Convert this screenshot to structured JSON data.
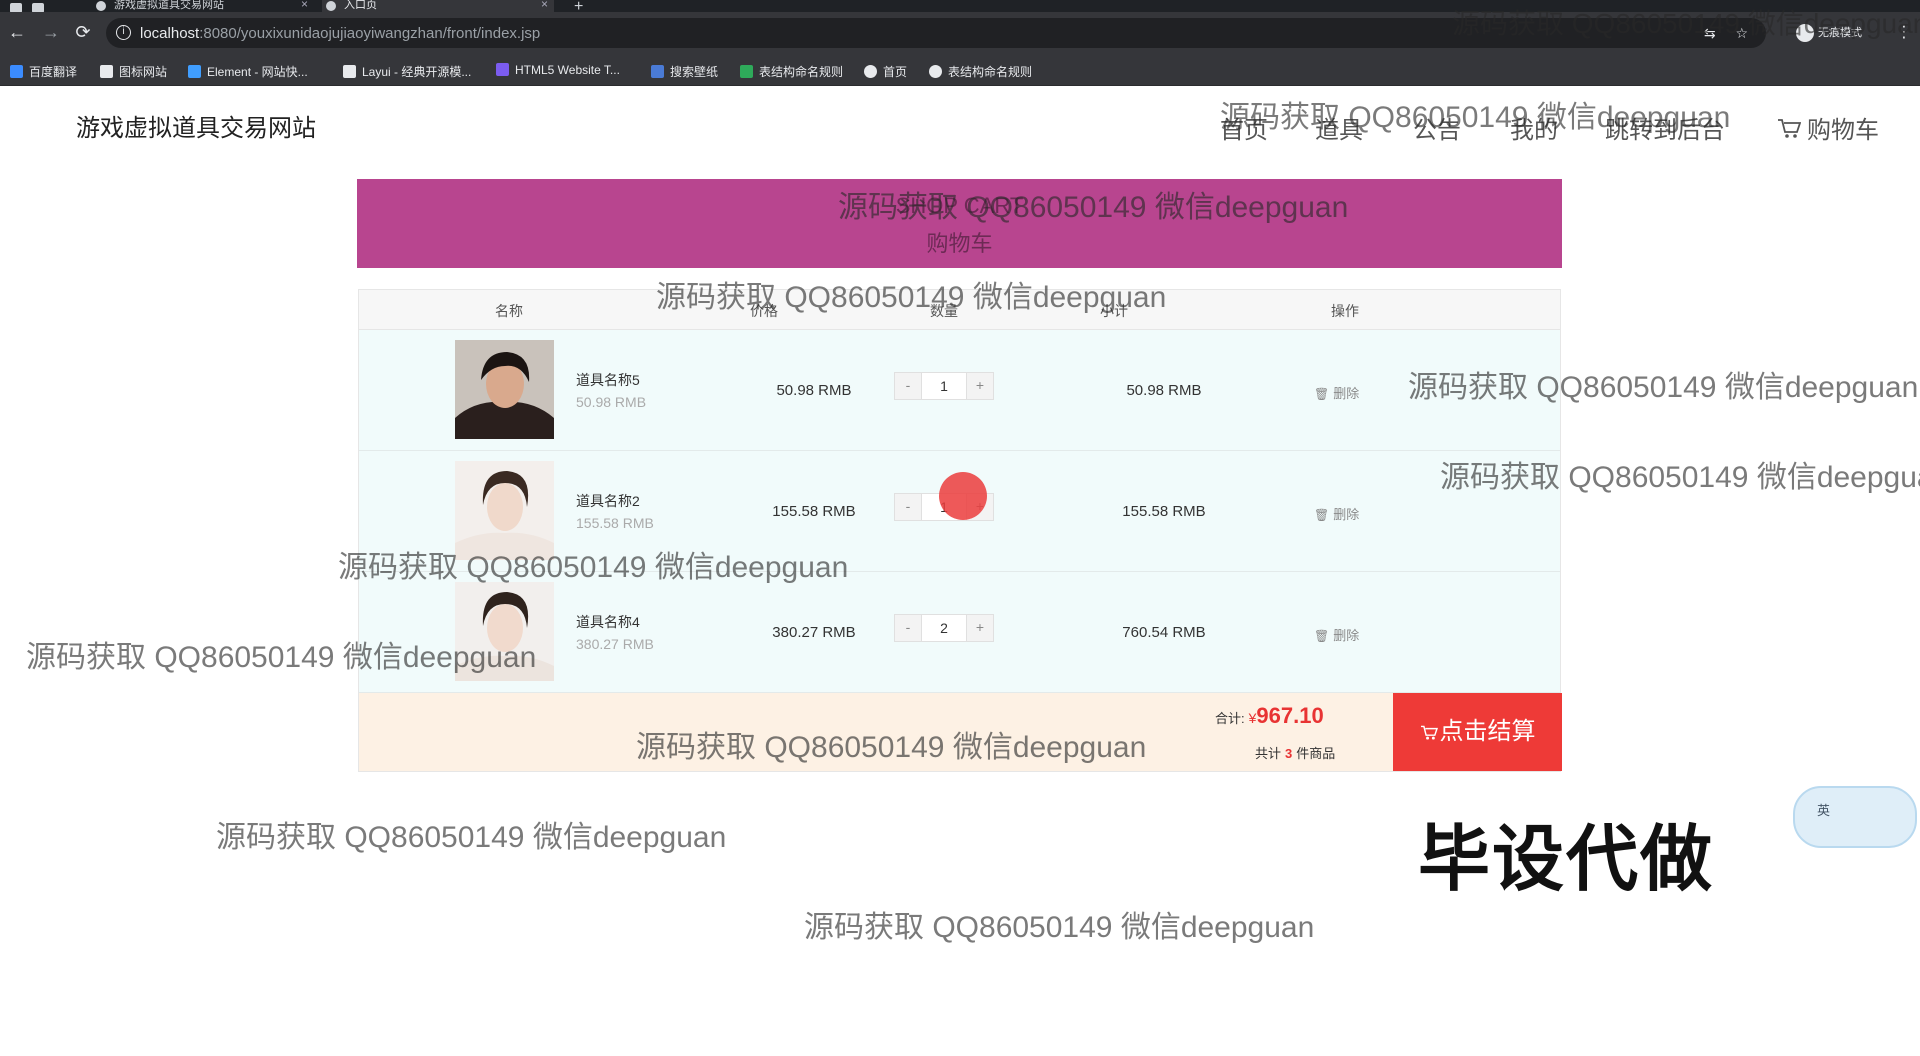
{
  "browser": {
    "tabs": [
      {
        "title": "游戏虚拟道具交易网站"
      },
      {
        "title": "入口页"
      }
    ],
    "url_host": "localhost",
    "url_path": ":8080/youxixunidaojujiaoyiwangzhan/front/index.jsp",
    "incognito_label": "无痕模式",
    "bookmarks": [
      {
        "label": "百度翻译",
        "color": "#3b8cff"
      },
      {
        "label": "图标网站",
        "color": "#e8eaed"
      },
      {
        "label": "Element - 网站快...",
        "color": "#409eff"
      },
      {
        "label": "Layui - 经典开源模...",
        "color": "#e8eaed"
      },
      {
        "label": "HTML5 Website T...",
        "color": "#7b5cf0"
      },
      {
        "label": "搜索壁纸",
        "color": "#4a7bd6"
      },
      {
        "label": "表结构命名规则",
        "color": "#2eaa5a"
      },
      {
        "label": "首页",
        "color": "#e8eaed"
      },
      {
        "label": "表结构命名规则",
        "color": "#e8eaed"
      }
    ]
  },
  "site": {
    "title": "游戏虚拟道具交易网站",
    "nav": [
      "首页",
      "道具",
      "公告",
      "我的",
      "跳转到后台",
      "购物车"
    ]
  },
  "banner": {
    "title": "SHOP CART",
    "subtitle": "购物车",
    "color": "#b8458f"
  },
  "cart": {
    "headers": [
      "名称",
      "价格",
      "数量",
      "小计",
      "操作"
    ],
    "rows": [
      {
        "name": "道具名称5",
        "unit_price": "50.98 RMB",
        "price": "50.98 RMB",
        "qty": "1",
        "subtotal": "50.98 RMB",
        "delete_label": "删除"
      },
      {
        "name": "道具名称2",
        "unit_price": "155.58 RMB",
        "price": "155.58 RMB",
        "qty": "1",
        "subtotal": "155.58 RMB",
        "delete_label": "删除"
      },
      {
        "name": "道具名称4",
        "unit_price": "380.27 RMB",
        "price": "380.27 RMB",
        "qty": "2",
        "subtotal": "760.54 RMB",
        "delete_label": "删除"
      }
    ],
    "minus": "-",
    "plus": "+",
    "total_label": "合计:",
    "currency": "¥",
    "total": "967.10",
    "count_prefix": "共计",
    "count": "3",
    "count_suffix": "件商品",
    "checkout_label": "点击结算",
    "accent_color": "#ee3a37"
  },
  "overlay": {
    "watermark": "源码获取 QQ86050149 微信deepguan",
    "big_label": "毕设代做",
    "widget_label": "英"
  }
}
